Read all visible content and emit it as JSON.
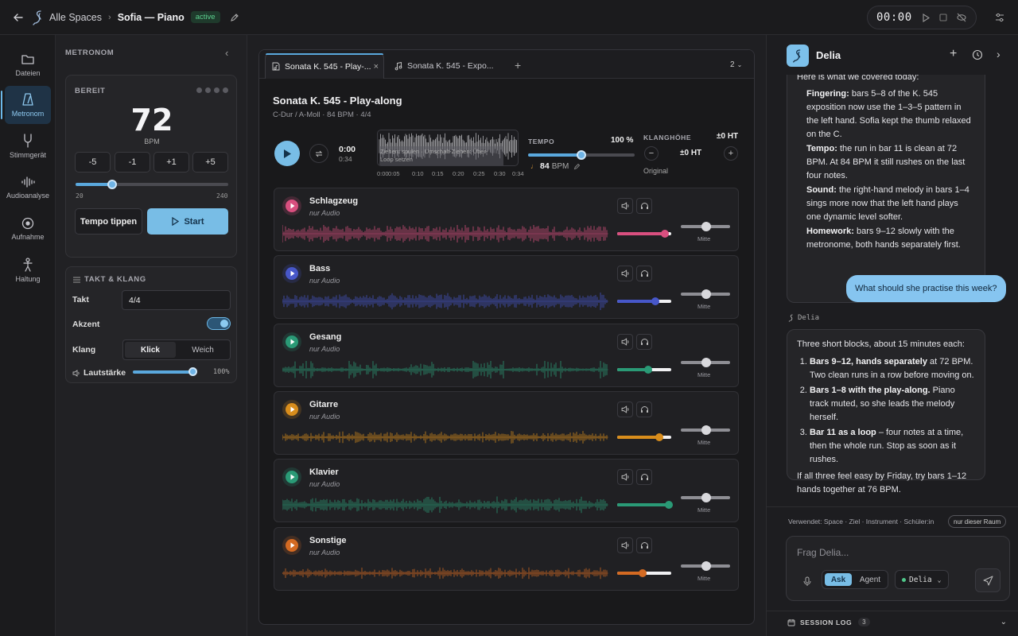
{
  "topbar": {
    "breadcrumb_root": "Alle Spaces",
    "space_title": "Sofia — Piano",
    "status_badge": "active",
    "timer": "00:00"
  },
  "rail": {
    "items": [
      {
        "label": "Dateien",
        "icon": "folder-icon"
      },
      {
        "label": "Metronom",
        "icon": "metronome-icon"
      },
      {
        "label": "Stimmgerät",
        "icon": "tuning-fork-icon"
      },
      {
        "label": "Audioanalyse",
        "icon": "audio-wave-icon"
      },
      {
        "label": "Aufnahme",
        "icon": "record-icon"
      },
      {
        "label": "Haltung",
        "icon": "posture-icon"
      }
    ]
  },
  "metronome": {
    "title": "METRONOM",
    "status": "BEREIT",
    "bpm": "72",
    "bpm_unit": "BPM",
    "steps": [
      "-5",
      "-1",
      "+1",
      "+5"
    ],
    "range_min": "20",
    "range_max": "240",
    "bpm_slider_fraction": 0.24,
    "tap_label": "Tempo tippen",
    "start_label": "Start",
    "takt_section_title": "TAKT & KLANG",
    "takt_label": "Takt",
    "takt_value": "4/4",
    "akzent_label": "Akzent",
    "akzent_on": true,
    "klang_label": "Klang",
    "klang_options": [
      "Klick",
      "Weich"
    ],
    "klang_selected": "Klick",
    "volume_label": "Lautstärke",
    "volume_value": "100%"
  },
  "player": {
    "tabs": [
      {
        "label": "Sonata K. 545 - Play-..."
      },
      {
        "label": "Sonata K. 545 - Expo..."
      }
    ],
    "tab_count": "2",
    "title": "Sonata K. 545 - Play-along",
    "meta": "C-Dur / A-Moll · 84 BPM · 4/4",
    "time_current": "0:00",
    "time_total": "0:34",
    "overview_hint": "Ziehen: spulen · Umschalt-Ziehen: Über-",
    "overview_hint2": "Loop setzen",
    "ticks": [
      "0:00",
      "0:05",
      "0:10",
      "0:15",
      "0:20",
      "0:25",
      "0:30",
      "0:34"
    ],
    "tempo_label": "TEMPO",
    "tempo_percent": "100 %",
    "tempo_slider_fraction": 0.5,
    "tempo_bpm": "84",
    "tempo_bpm_unit": "BPM",
    "pitch_label": "KLANGHÖHE",
    "pitch_value": "±0 HT",
    "pitch_center": "±0 HT",
    "pitch_minus": "−",
    "pitch_plus": "+",
    "pitch_original": "Original",
    "tracks": [
      {
        "name": "Schlagzeug",
        "sub": "nur Audio",
        "color": "#d94f7f",
        "volume": 0.88,
        "pan": "Mitte"
      },
      {
        "name": "Bass",
        "sub": "nur Audio",
        "color": "#4757c9",
        "volume": 0.7,
        "pan": "Mitte"
      },
      {
        "name": "Gesang",
        "sub": "nur Audio",
        "color": "#2a9a76",
        "volume": 0.58,
        "pan": "Mitte"
      },
      {
        "name": "Gitarre",
        "sub": "nur Audio",
        "color": "#d88d1c",
        "volume": 0.78,
        "pan": "Mitte"
      },
      {
        "name": "Klavier",
        "sub": "nur Audio",
        "color": "#2a9a76",
        "volume": 0.96,
        "pan": "Mitte"
      },
      {
        "name": "Sonstige",
        "sub": "nur Audio",
        "color": "#d46a22",
        "volume": 0.47,
        "pan": "Mitte"
      }
    ]
  },
  "assistant": {
    "name": "Delia",
    "summary_intro": "Here is what we covered today:",
    "summary_items": [
      {
        "term": "Fingering:",
        "text": "bars 5–8 of the K. 545 exposition now use the 1–3–5 pattern in the left hand. Sofia kept the thumb relaxed on the C."
      },
      {
        "term": "Tempo:",
        "text": "the run in bar 11 is clean at 72 BPM. At 84 BPM it still rushes on the last four notes."
      },
      {
        "term": "Sound:",
        "text": "the right-hand melody in bars 1–4 sings more now that the left hand plays one dynamic level softer."
      },
      {
        "term": "Homework:",
        "text": "bars 9–12 slowly with the metronome, both hands separately first."
      }
    ],
    "user_message": "What should she practise this week?",
    "reply_author": "Delia",
    "reply_intro": "Three short blocks, about 15 minutes each:",
    "reply_items": [
      {
        "term": "Bars 9–12, hands separately",
        "text": "at 72 BPM. Two clean runs in a row before moving on."
      },
      {
        "term": "Bars 1–8 with the play-along.",
        "text": "Piano track muted, so she leads the melody herself."
      },
      {
        "term": "Bar 11 as a loop",
        "text": "– four notes at a time, then the whole run. Stop as soon as it rushes."
      }
    ],
    "reply_outro": "If all three feel easy by Friday, try bars 1–12 hands together at 76 BPM.",
    "context_label": "Verwendet: Space · Ziel · Instrument · Schüler:in",
    "scope_chip": "nur dieser Raum",
    "input_placeholder": "Frag Delia...",
    "mode_ask": "Ask",
    "mode_agent": "Agent",
    "model": "Delia",
    "session_log": "SESSION LOG",
    "session_log_count": "3"
  }
}
